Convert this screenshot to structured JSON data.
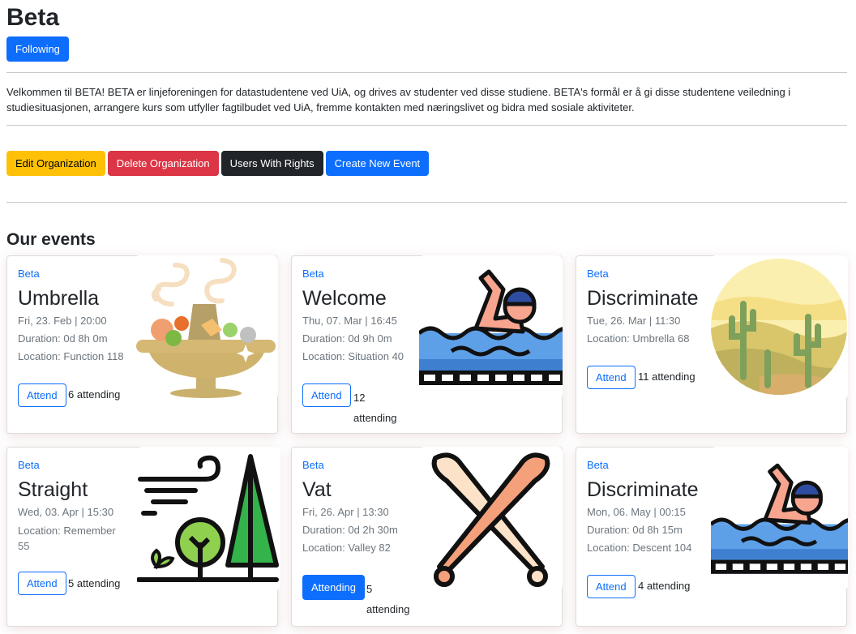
{
  "org": {
    "name": "Beta",
    "follow_label": "Following",
    "description": "Velkommen til BETA! BETA er linjeforeningen for datastudentene ved UiA, og drives av studenter ved disse studiene. BETA's formål er å gi disse studentene veiledning i studiesituasjonen, arrangere kurs som utfyller fagtilbudet ved UiA, fremme kontakten med næringslivet og bidra med sosiale aktiviteter."
  },
  "actions": {
    "edit": "Edit Organization",
    "delete": "Delete Organization",
    "users": "Users With Rights",
    "create": "Create New Event"
  },
  "events_heading": "Our events",
  "events": [
    {
      "org": "Beta",
      "title": "Umbrella",
      "date": "Fri, 23. Feb | 20:00",
      "duration": "Duration: 0d 8h 0m",
      "location": "Location: Function 118",
      "attend_label": "Attend",
      "attending": "6 attending",
      "image": "hot-pot-icon"
    },
    {
      "org": "Beta",
      "title": "Welcome",
      "date": "Thu, 07. Mar | 16:45",
      "duration": "Duration: 0d 9h 0m",
      "location": "Location: Situation 40",
      "attend_label": "Attend",
      "attending": "12 attending",
      "image": "swimmer-icon"
    },
    {
      "org": "Beta",
      "title": "Discriminate",
      "date": "Tue, 26. Mar | 11:30",
      "duration": "",
      "location": "Location: Umbrella 68",
      "attend_label": "Attend",
      "attending": "11 attending",
      "image": "desert-cactus-icon"
    },
    {
      "org": "Beta",
      "title": "Straight",
      "date": "Wed, 03. Apr | 15:30",
      "duration": "",
      "location": "Location: Remember 55",
      "attend_label": "Attend",
      "attending": "5 attending",
      "image": "wind-trees-icon"
    },
    {
      "org": "Beta",
      "title": "Vat",
      "date": "Fri, 26. Apr | 13:30",
      "duration": "Duration: 0d 2h 30m",
      "location": "Location: Valley 82",
      "attend_label": "Attending",
      "attending": "5 attending",
      "image": "crossed-bats-icon"
    },
    {
      "org": "Beta",
      "title": "Discriminate",
      "date": "Mon, 06. May | 00:15",
      "duration": "Duration: 0d 8h 15m",
      "location": "Location: Descent 104",
      "attend_label": "Attend",
      "attending": "4 attending",
      "image": "swimmer-icon"
    }
  ],
  "colors": {
    "primary": "#0d6efd",
    "warning": "#ffc107",
    "danger": "#dc3545",
    "dark": "#212529"
  }
}
